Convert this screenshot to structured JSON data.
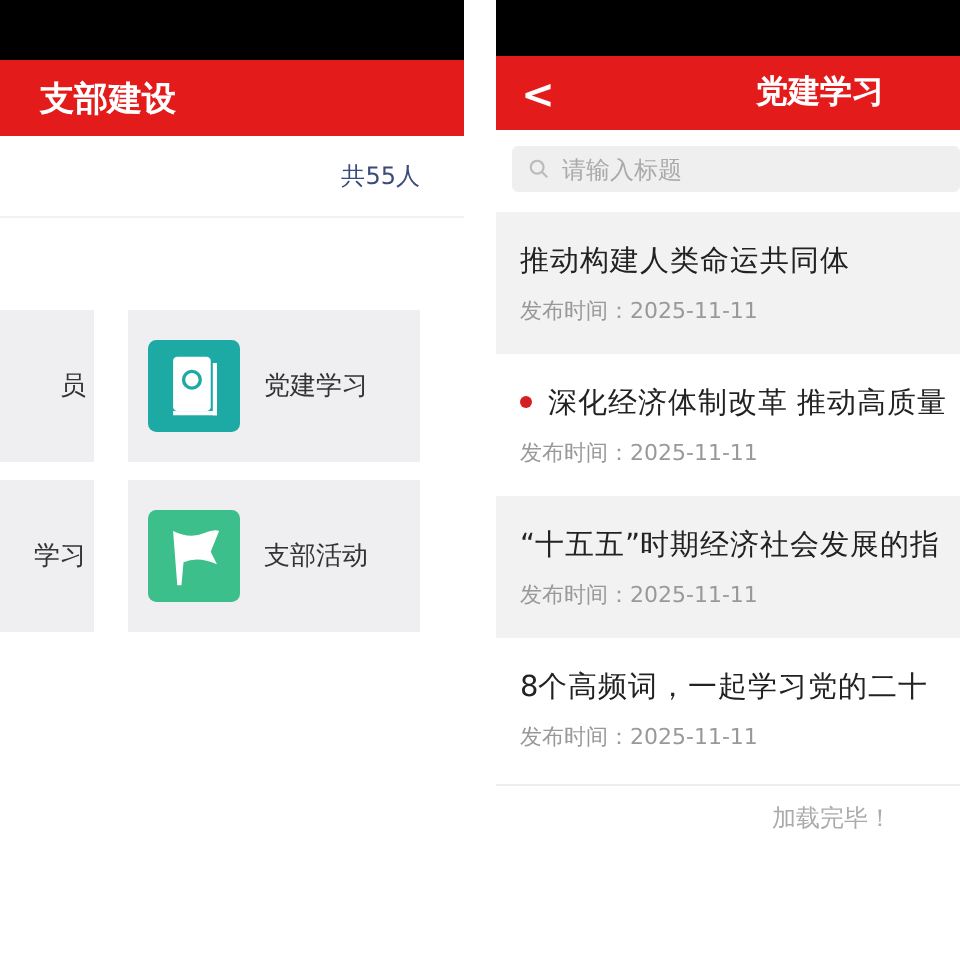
{
  "branch_screen": {
    "title": "支部建设",
    "member_count": "共55人",
    "menu": [
      {
        "label": "员"
      },
      {
        "label": "党建学习",
        "kind": "book"
      },
      {
        "label": "学习"
      },
      {
        "label": "支部活动",
        "kind": "flag"
      }
    ]
  },
  "study_screen": {
    "title": "党建学习",
    "back": "<",
    "search": {
      "placeholder": "请输入标题"
    },
    "articles": [
      {
        "title": "推动构建人类命运共同体",
        "date": "发布时间：2025-11-11",
        "marked": false
      },
      {
        "title": "深化经济体制改革 推动高质量",
        "date": "发布时间：2025-11-11",
        "marked": true
      },
      {
        "title": "“十五五”时期经济社会发展的指",
        "date": "发布时间：2025-11-11",
        "marked": false
      },
      {
        "title": "8个高频词，一起学习党的二十",
        "date": "发布时间：2025-11-11",
        "marked": false
      }
    ],
    "footer": "加载完毕！"
  }
}
